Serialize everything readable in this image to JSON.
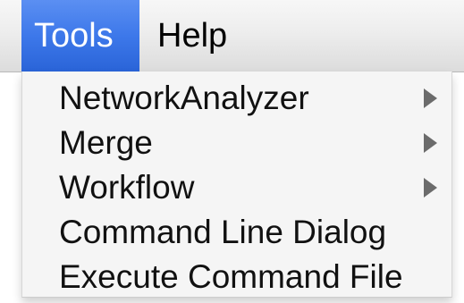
{
  "menubar": {
    "items": [
      {
        "label": "Tools",
        "selected": true
      },
      {
        "label": "Help",
        "selected": false
      }
    ],
    "accent_color": "#3d78ea"
  },
  "dropdown": {
    "items": [
      {
        "label": "NetworkAnalyzer",
        "has_submenu": true,
        "icon": "submenu-arrow-icon"
      },
      {
        "label": "Merge",
        "has_submenu": true,
        "icon": "submenu-arrow-icon"
      },
      {
        "label": "Workflow",
        "has_submenu": true,
        "icon": "submenu-arrow-icon"
      },
      {
        "label": "Command Line Dialog",
        "has_submenu": false
      },
      {
        "label": "Execute Command File",
        "has_submenu": false
      }
    ]
  }
}
